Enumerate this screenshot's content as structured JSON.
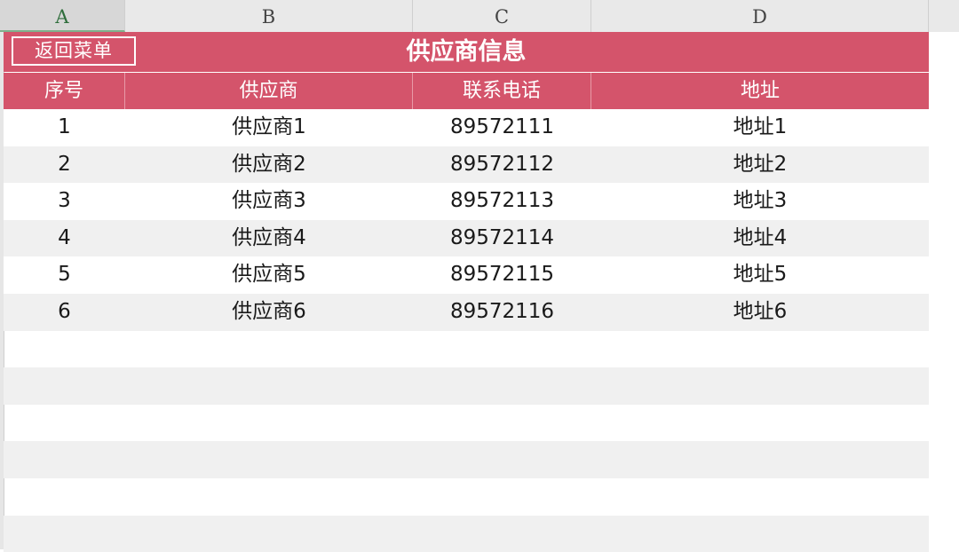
{
  "column_headers": [
    "A",
    "B",
    "C",
    "D"
  ],
  "title_bar": {
    "back_label": "返回菜单",
    "title": "供应商信息",
    "color": "#d4546b"
  },
  "table": {
    "headers": [
      "序号",
      "供应商",
      "联系电话",
      "地址"
    ],
    "rows": [
      [
        "1",
        "供应商1",
        "89572111",
        "地址1"
      ],
      [
        "2",
        "供应商2",
        "89572112",
        "地址2"
      ],
      [
        "3",
        "供应商3",
        "89572113",
        "地址3"
      ],
      [
        "4",
        "供应商4",
        "89572114",
        "地址4"
      ],
      [
        "5",
        "供应商5",
        "89572115",
        "地址5"
      ],
      [
        "6",
        "供应商6",
        "89572116",
        "地址6"
      ]
    ]
  }
}
